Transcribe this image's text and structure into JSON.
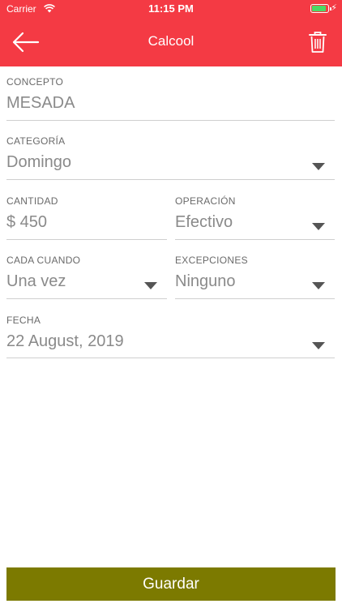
{
  "status_bar": {
    "carrier": "Carrier",
    "time": "11:15 PM",
    "battery_icon": "battery-charging-icon",
    "charging_glyph": "⚡"
  },
  "header": {
    "title": "Calcool",
    "back_icon": "arrow-left-icon",
    "delete_icon": "trash-icon"
  },
  "form": {
    "concepto": {
      "label": "CONCEPTO",
      "value": "MESADA"
    },
    "categoria": {
      "label": "CATEGORÍA",
      "value": "Domingo"
    },
    "cantidad": {
      "label": "CANTIDAD",
      "value": "$ 450"
    },
    "operacion": {
      "label": "OPERACIÓN",
      "value": "Efectivo"
    },
    "cada_cuando": {
      "label": "CADA CUANDO",
      "value": "Una vez"
    },
    "excepciones": {
      "label": "EXCEPCIONES",
      "value": "Ninguno"
    },
    "fecha": {
      "label": "FECHA",
      "value": "22 August, 2019"
    }
  },
  "footer": {
    "save_label": "Guardar"
  },
  "colors": {
    "header": "#f43a44",
    "save_button": "#7c7a00",
    "battery": "#4cd964"
  }
}
